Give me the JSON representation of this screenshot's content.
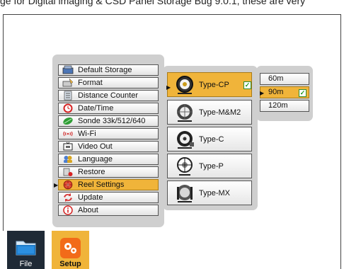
{
  "header": {
    "clipped_text": "ge for Digital lmaging & CSD Panel Storage Bug 9.0.1, these are very"
  },
  "menu": {
    "items": [
      {
        "label": "Default Storage",
        "icon": "storage-icon"
      },
      {
        "label": "Format",
        "icon": "format-icon"
      },
      {
        "label": "Distance Counter",
        "icon": "distance-counter-icon"
      },
      {
        "label": "Date/Time",
        "icon": "clock-icon"
      },
      {
        "label": "Sonde 33k/512/640",
        "icon": "sonde-icon"
      },
      {
        "label": "Wi-Fi",
        "icon": "wifi-icon"
      },
      {
        "label": "Video Out",
        "icon": "video-out-icon"
      },
      {
        "label": "Language",
        "icon": "language-icon"
      },
      {
        "label": "Restore",
        "icon": "restore-icon"
      },
      {
        "label": "Reel Settings",
        "icon": "reel-settings-icon",
        "selected": true
      },
      {
        "label": "Update",
        "icon": "update-icon"
      },
      {
        "label": "About",
        "icon": "info-icon"
      }
    ]
  },
  "reel": {
    "items": [
      {
        "label": "Type-CP",
        "selected": true,
        "checked": true
      },
      {
        "label": "Type-M&M2"
      },
      {
        "label": "Type-C"
      },
      {
        "label": "Type-P"
      },
      {
        "label": "Type-MX"
      }
    ]
  },
  "length": {
    "items": [
      {
        "label": "60m"
      },
      {
        "label": "90m",
        "selected": true,
        "checked": true
      },
      {
        "label": "120m"
      }
    ]
  },
  "tabs": {
    "file": {
      "label": "File",
      "icon": "folder-icon"
    },
    "setup": {
      "label": "Setup",
      "icon": "gears-icon"
    }
  },
  "colors": {
    "accent": "#f0b43a",
    "panel": "#cfcfcf",
    "file_tab": "#1f2a36"
  }
}
